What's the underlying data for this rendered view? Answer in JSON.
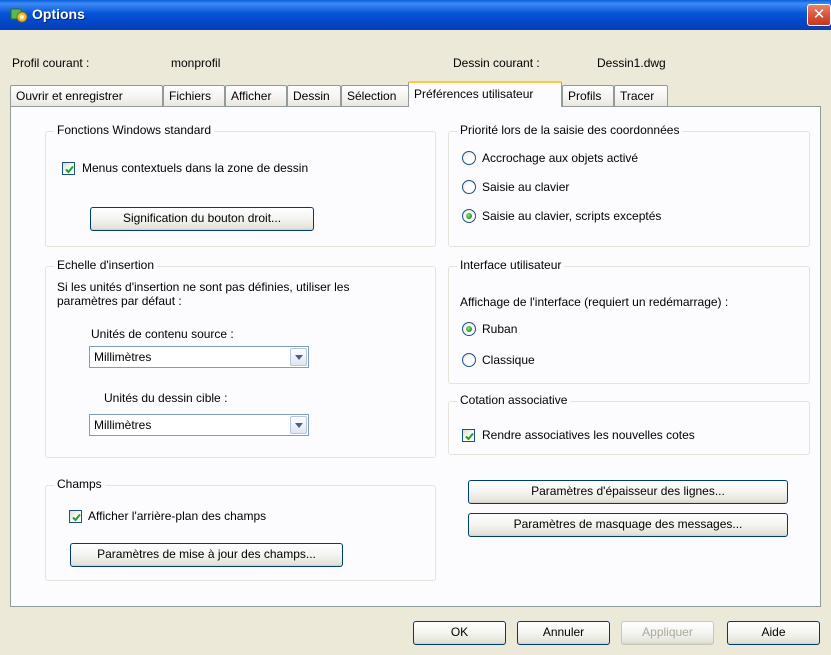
{
  "window": {
    "title": "Options",
    "close_glyph": "✕"
  },
  "header": {
    "profile_label": "Profil courant :",
    "profile_value": "monprofil",
    "drawing_label": "Dessin courant :",
    "drawing_value": "Dessin1.dwg"
  },
  "tabs": [
    {
      "label": "Ouvrir et enregistrer"
    },
    {
      "label": "Fichiers"
    },
    {
      "label": "Afficher"
    },
    {
      "label": "Dessin"
    },
    {
      "label": "Sélection"
    },
    {
      "label": "Préférences utilisateur",
      "active": true
    },
    {
      "label": "Profils"
    },
    {
      "label": "Tracer"
    }
  ],
  "windows_std": {
    "title": "Fonctions Windows standard",
    "context_menu_label": "Menus contextuels dans la zone de dessin",
    "context_menu_checked": true,
    "right_click_button": "Signification du bouton droit..."
  },
  "insertion": {
    "title": "Echelle d'insertion",
    "description": "Si les unités d'insertion ne sont pas définies,  utiliser les paramètres par défaut :",
    "source_label": "Unités de contenu source :",
    "source_value": "Millimètres",
    "target_label": "Unités du dessin cible :",
    "target_value": "Millimètres"
  },
  "fields": {
    "title": "Champs",
    "background_label": "Afficher l'arrière-plan des champs",
    "background_checked": true,
    "update_button": "Paramètres de mise à jour des champs..."
  },
  "coord_priority": {
    "title": "Priorité lors de la saisie des coordonnées",
    "options": [
      {
        "label": "Accrochage aux objets activé",
        "checked": false
      },
      {
        "label": "Saisie au clavier",
        "checked": false
      },
      {
        "label": "Saisie au clavier, scripts exceptés",
        "checked": true
      }
    ]
  },
  "ui": {
    "title": "Interface utilisateur",
    "description": "Affichage de l'interface (requiert un redémarrage) :",
    "options": [
      {
        "label": "Ruban",
        "checked": true
      },
      {
        "label": "Classique",
        "checked": false
      }
    ]
  },
  "assoc": {
    "title": "Cotation associative",
    "checkbox_label": "Rendre associatives les nouvelles cotes",
    "checked": true
  },
  "right_buttons": {
    "lineweight": "Paramètres d'épaisseur des lignes...",
    "hide_messages": "Paramètres de masquage des messages..."
  },
  "footer": {
    "ok": "OK",
    "cancel": "Annuler",
    "apply": "Appliquer",
    "help": "Aide"
  },
  "icons": {
    "title_icon": "options-gear-icon",
    "close": "close-icon",
    "dropdown": "chevron-down-icon",
    "check": "check-icon"
  },
  "colors": {
    "titlebar": "#0654d6",
    "dialog_bg": "#ece9d8",
    "panel_bg": "#fcfcfe",
    "active_tab_accent": "#ffc83c",
    "close_button": "#d8553b",
    "radio_dot": "#2f9e2f"
  }
}
